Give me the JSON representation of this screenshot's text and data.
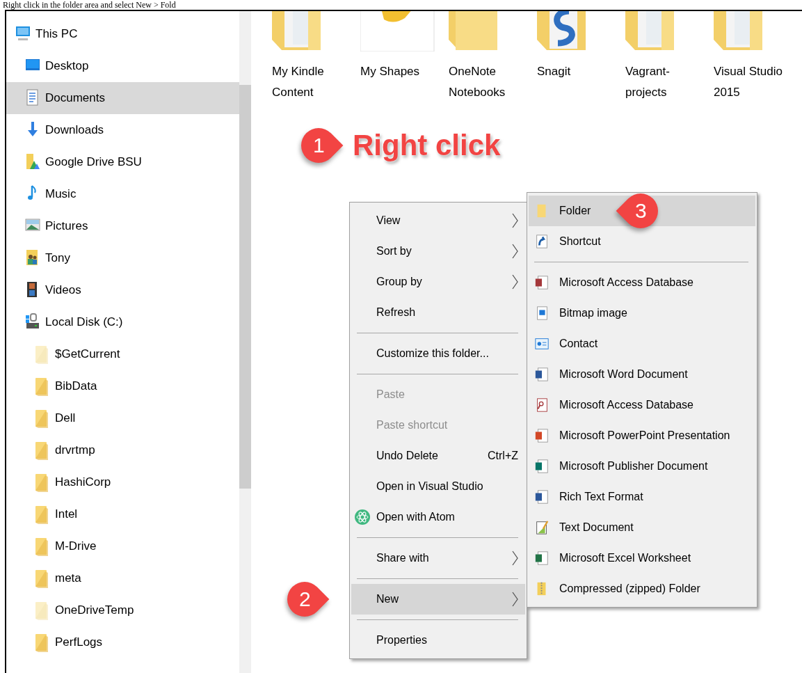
{
  "caption": "Right click in the folder area and select New > Fold",
  "sidebar": {
    "items": [
      {
        "label": "This PC",
        "kind": "pc",
        "selected": false,
        "children": [
          {
            "label": "Desktop",
            "kind": "desktop",
            "selected": false
          },
          {
            "label": "Documents",
            "kind": "documents",
            "selected": true
          },
          {
            "label": "Downloads",
            "kind": "downloads",
            "selected": false
          },
          {
            "label": "Google Drive BSU",
            "kind": "drive",
            "selected": false
          },
          {
            "label": "Music",
            "kind": "music",
            "selected": false
          },
          {
            "label": "Pictures",
            "kind": "pictures",
            "selected": false
          },
          {
            "label": "Tony",
            "kind": "user",
            "selected": false
          },
          {
            "label": "Videos",
            "kind": "videos",
            "selected": false
          },
          {
            "label": "Local Disk (C:)",
            "kind": "disk",
            "selected": false,
            "children": [
              {
                "label": "$GetCurrent",
                "kind": "folder",
                "hidden": true,
                "selected": false
              },
              {
                "label": "BibData",
                "kind": "folder",
                "hidden": false,
                "selected": false
              },
              {
                "label": "Dell",
                "kind": "folder",
                "hidden": false,
                "selected": false
              },
              {
                "label": "drvrtmp",
                "kind": "folder",
                "hidden": false,
                "selected": false
              },
              {
                "label": "HashiCorp",
                "kind": "folder",
                "hidden": false,
                "selected": false
              },
              {
                "label": "Intel",
                "kind": "folder",
                "hidden": false,
                "selected": false
              },
              {
                "label": "M-Drive",
                "kind": "folder",
                "hidden": false,
                "selected": false
              },
              {
                "label": "meta",
                "kind": "folder",
                "hidden": false,
                "selected": false
              },
              {
                "label": "OneDriveTemp",
                "kind": "folder",
                "hidden": true,
                "selected": false
              },
              {
                "label": "PerfLogs",
                "kind": "folder",
                "hidden": false,
                "selected": false
              }
            ]
          }
        ]
      }
    ]
  },
  "files": [
    {
      "name": "My Kindle Content",
      "kind": "folder-docs"
    },
    {
      "name": "My Shapes",
      "kind": "shapes"
    },
    {
      "name": "OneNote Notebooks",
      "kind": "folder"
    },
    {
      "name": "Snagit",
      "kind": "snagit"
    },
    {
      "name": "Vagrant-projects",
      "kind": "folder-docs"
    },
    {
      "name": "Visual Studio 2015",
      "kind": "folder-docs"
    }
  ],
  "step_callout": {
    "number": "1",
    "label": "Right click"
  },
  "context_menu": {
    "groups": [
      [
        {
          "label": "View",
          "submenu": true,
          "disabled": false,
          "selected": false
        },
        {
          "label": "Sort by",
          "submenu": true,
          "disabled": false,
          "selected": false
        },
        {
          "label": "Group by",
          "submenu": true,
          "disabled": false,
          "selected": false
        },
        {
          "label": "Refresh",
          "submenu": false,
          "disabled": false,
          "selected": false
        }
      ],
      [
        {
          "label": "Customize this folder...",
          "submenu": false,
          "disabled": false,
          "selected": false
        }
      ],
      [
        {
          "label": "Paste",
          "submenu": false,
          "disabled": true,
          "selected": false
        },
        {
          "label": "Paste shortcut",
          "submenu": false,
          "disabled": true,
          "selected": false
        },
        {
          "label": "Undo Delete",
          "shortcut": "Ctrl+Z",
          "submenu": false,
          "disabled": false,
          "selected": false
        },
        {
          "label": "Open in Visual Studio",
          "submenu": false,
          "disabled": false,
          "selected": false
        },
        {
          "label": "Open with Atom",
          "has_icon": true,
          "submenu": false,
          "disabled": false,
          "selected": false
        }
      ],
      [
        {
          "label": "Share with",
          "submenu": true,
          "disabled": false,
          "selected": false
        }
      ],
      [
        {
          "label": "New",
          "submenu": true,
          "disabled": false,
          "selected": true,
          "callout": "2"
        }
      ],
      [
        {
          "label": "Properties",
          "submenu": false,
          "disabled": false,
          "selected": false
        }
      ]
    ]
  },
  "new_submenu": {
    "groups": [
      [
        {
          "label": "Folder",
          "kind": "folder",
          "selected": true,
          "callout": "3"
        },
        {
          "label": "Shortcut",
          "kind": "shortcut",
          "selected": false
        }
      ],
      [
        {
          "label": "Microsoft Access Database",
          "kind": "access",
          "selected": false
        },
        {
          "label": "Bitmap image",
          "kind": "bitmap",
          "selected": false
        },
        {
          "label": "Contact",
          "kind": "contact",
          "selected": false
        },
        {
          "label": "Microsoft Word Document",
          "kind": "word",
          "selected": false
        },
        {
          "label": "Microsoft Access Database",
          "kind": "access-doc",
          "selected": false
        },
        {
          "label": "Microsoft PowerPoint Presentation",
          "kind": "powerpoint",
          "selected": false
        },
        {
          "label": "Microsoft Publisher Document",
          "kind": "publisher",
          "selected": false
        },
        {
          "label": "Rich Text Format",
          "kind": "rtf",
          "selected": false
        },
        {
          "label": "Text Document",
          "kind": "text",
          "selected": false
        },
        {
          "label": "Microsoft Excel Worksheet",
          "kind": "excel",
          "selected": false
        },
        {
          "label": "Compressed (zipped) Folder",
          "kind": "zip",
          "selected": false
        }
      ]
    ]
  }
}
